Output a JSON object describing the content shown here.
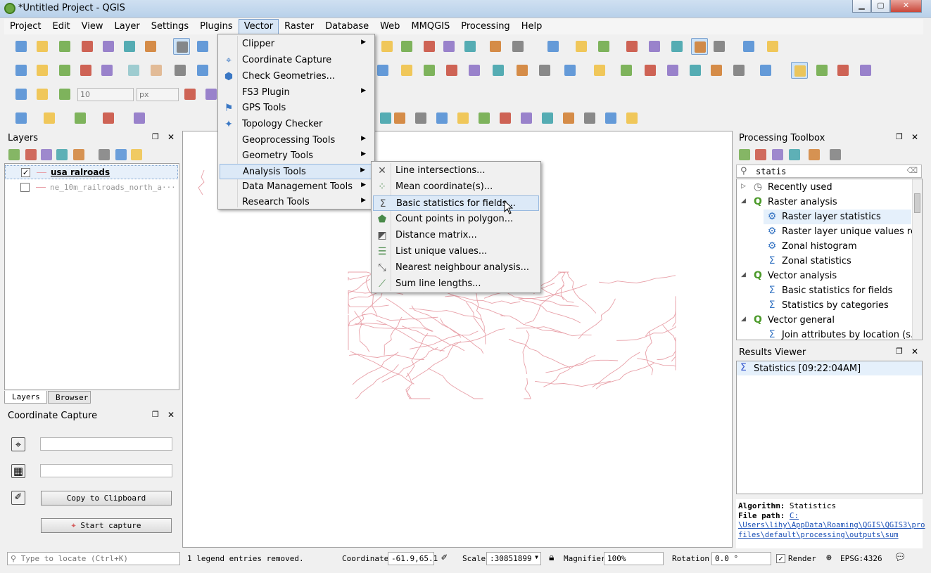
{
  "window": {
    "title": "*Untitled Project - QGIS",
    "minimize": "▁",
    "maximize": "▢",
    "close": "✕"
  },
  "menubar": [
    "Project",
    "Edit",
    "View",
    "Layer",
    "Settings",
    "Plugins",
    "Vector",
    "Raster",
    "Database",
    "Web",
    "MMQGIS",
    "Processing",
    "Help"
  ],
  "toolbar": {
    "width_value": "10",
    "unit_value": "px"
  },
  "layers_panel": {
    "title": "Layers",
    "layers": [
      {
        "name": "usa ralroads",
        "checked": true,
        "checkmark": "✓",
        "color": "#e8a0a8"
      },
      {
        "name": "ne_10m_railroads_north_a···",
        "checked": false,
        "checkmark": "",
        "color": "#e8a0a8"
      }
    ],
    "tabs": [
      "Layers",
      "Browser"
    ]
  },
  "coord_capture": {
    "title": "Coordinate Capture",
    "copy_label": "Copy to Clipboard",
    "start_label": "Start capture",
    "icons": [
      "⌖",
      "▦",
      "✐"
    ]
  },
  "vector_menu": {
    "items": [
      {
        "label": "Clipper",
        "icon": "",
        "submenu": true
      },
      {
        "label": "Coordinate Capture",
        "icon": "⌖",
        "submenu": false
      },
      {
        "label": "Check Geometries...",
        "icon": "⬢",
        "submenu": false
      },
      {
        "label": "FS3 Plugin",
        "icon": "",
        "submenu": true
      },
      {
        "label": "GPS Tools",
        "icon": "⚑",
        "submenu": false
      },
      {
        "label": "Topology Checker",
        "icon": "✦",
        "submenu": false
      },
      {
        "label": "Geoprocessing Tools",
        "icon": "",
        "submenu": true
      },
      {
        "label": "Geometry Tools",
        "icon": "",
        "submenu": true
      },
      {
        "label": "Analysis Tools",
        "icon": "",
        "submenu": true
      },
      {
        "label": "Data Management Tools",
        "icon": "",
        "submenu": true
      },
      {
        "label": "Research Tools",
        "icon": "",
        "submenu": true
      }
    ],
    "highlighted": "Analysis Tools",
    "arrow": "▶"
  },
  "analysis_menu": {
    "items": [
      {
        "label": "Line intersections...",
        "icon": "✕"
      },
      {
        "label": "Mean coordinate(s)...",
        "icon": "⁘"
      },
      {
        "label": "Basic statistics for fields...",
        "icon": "Σ"
      },
      {
        "label": "Count points in polygon...",
        "icon": "⬟"
      },
      {
        "label": "Distance matrix...",
        "icon": "◩"
      },
      {
        "label": "List unique values...",
        "icon": "☰"
      },
      {
        "label": "Nearest neighbour analysis...",
        "icon": "⤡"
      },
      {
        "label": "Sum line lengths...",
        "icon": "⟋"
      }
    ],
    "highlighted": "Basic statistics for fields..."
  },
  "processing_toolbox": {
    "title": "Processing Toolbox",
    "search_value": "statis",
    "tree": [
      {
        "label": "Recently used",
        "level": 0,
        "icon": "◷",
        "expander": "▷"
      },
      {
        "label": "Raster analysis",
        "level": 0,
        "icon": "Q",
        "expander": "◢"
      },
      {
        "label": "Raster layer statistics",
        "level": 1,
        "icon": "⚙",
        "expander": ""
      },
      {
        "label": "Raster layer unique values re...",
        "level": 1,
        "icon": "⚙",
        "expander": ""
      },
      {
        "label": "Zonal histogram",
        "level": 1,
        "icon": "⚙",
        "expander": ""
      },
      {
        "label": "Zonal statistics",
        "level": 1,
        "icon": "Σ",
        "expander": ""
      },
      {
        "label": "Vector analysis",
        "level": 0,
        "icon": "Q",
        "expander": "◢"
      },
      {
        "label": "Basic statistics for fields",
        "level": 1,
        "icon": "Σ",
        "expander": ""
      },
      {
        "label": "Statistics by categories",
        "level": 1,
        "icon": "Σ",
        "expander": ""
      },
      {
        "label": "Vector general",
        "level": 0,
        "icon": "Q",
        "expander": "◢"
      },
      {
        "label": "Join attributes by location (s...",
        "level": 1,
        "icon": "Σ",
        "expander": ""
      }
    ]
  },
  "results_viewer": {
    "title": "Results Viewer",
    "entries": [
      {
        "label": "Statistics [09:22:04AM]",
        "icon": "Σ"
      }
    ],
    "algorithm_label": "Algorithm:",
    "algorithm_value": "Statistics",
    "filepath_label": "File path:",
    "filepath_lines": [
      "C:",
      "\\Users\\lihy\\AppData\\Roaming\\QGIS\\QGIS3\\pro",
      "files\\default\\processing\\outputs\\sum"
    ]
  },
  "statusbar": {
    "locate_placeholder": "Type to locate (Ctrl+K)",
    "message": "1 legend entries removed.",
    "coordinate_label": "Coordinate",
    "coordinate_value": "-61.9,65.1",
    "scale_label": "Scale",
    "scale_value": ":30851899",
    "magnifier_label": "Magnifier",
    "magnifier_value": "100%",
    "rotation_label": "Rotation",
    "rotation_value": "0.0 °",
    "render_label": "Render",
    "render_check": "✓",
    "crs": "EPSG:4326"
  },
  "colors": {
    "accent": "#7da2ce",
    "railroad": "#e8a0a8",
    "menu_highlight": "#dce9f7"
  }
}
